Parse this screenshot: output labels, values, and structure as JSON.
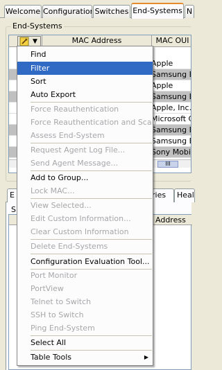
{
  "tabs": [
    "Welcome",
    "Configuration",
    "Switches",
    "End-Systems",
    "N"
  ],
  "active_tab": "End-Systems",
  "group_title": "End-Systems",
  "table": {
    "columns": [
      "MAC Address",
      "MAC OUI"
    ],
    "oui_values": [
      "Apple",
      "Samsung Ele",
      "Apple",
      "Samsung Ele",
      "Apple, Inc.",
      "Microsoft Co",
      "Samsung Ele",
      "Samsung Ele",
      "Sony Mobile"
    ],
    "scroll_grip": "III"
  },
  "lower": {
    "tabs": [
      "E",
      "ries",
      "Healt"
    ],
    "side_label": "S",
    "column": "Address"
  },
  "icons": {
    "tool": "wrench-icon",
    "dropdown": "dropdown-arrow-icon",
    "submenu": "submenu-arrow-icon"
  },
  "menu": {
    "find": "Find",
    "filter": "Filter",
    "sort": "Sort",
    "auto_export": "Auto Export",
    "force_reauth": "Force Reauthentication",
    "force_reauth_scan": "Force Reauthentication and Scan",
    "assess": "Assess End-System",
    "request_log": "Request Agent Log File...",
    "send_message": "Send Agent Message...",
    "add_group": "Add to Group...",
    "lock_mac": "Lock MAC...",
    "view_selected": "View Selected...",
    "edit_custom": "Edit Custom Information...",
    "clear_custom": "Clear Custom Information",
    "delete": "Delete End-Systems",
    "config_eval": "Configuration Evaluation Tool...",
    "port_monitor": "Port Monitor",
    "portview": "PortView",
    "telnet": "Telnet to Switch",
    "ssh": "SSH to Switch",
    "ping": "Ping End-System",
    "select_all": "Select All",
    "table_tools": "Table Tools"
  },
  "colors": {
    "highlight": "#316ac5",
    "active_tab_accent": "#e68b2c",
    "disabled_text": "#a7a6aa"
  }
}
